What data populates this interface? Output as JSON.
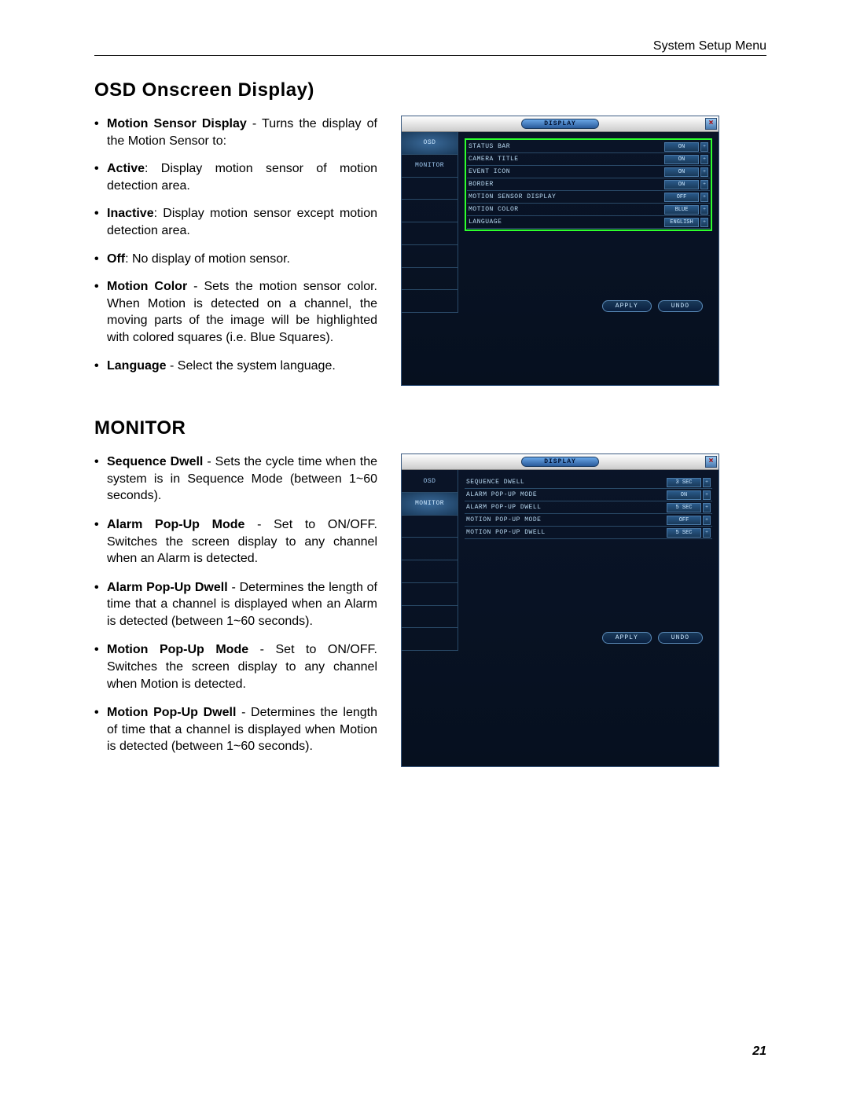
{
  "header": {
    "label": "System Setup Menu"
  },
  "page_number": "21",
  "section1": {
    "title": "OSD Onscreen Display)",
    "items": [
      {
        "bold": "Motion Sensor Display",
        "text": " - Turns the display of the Motion Sensor to:"
      }
    ],
    "sub_items": [
      {
        "bold": "Active",
        "text": ": Display motion sensor of motion detection area."
      },
      {
        "bold": "Inactive",
        "text": ": Display motion sensor except motion detection area."
      },
      {
        "bold": "Off",
        "text": ": No display of motion sensor."
      },
      {
        "bold": "Motion Color",
        "text": " - Sets the motion sensor color. When Motion is detected on a channel, the moving parts of the image will be highlighted with colored squares (i.e. Blue Squares)."
      },
      {
        "bold": "Language",
        "text": " - Select the system language."
      }
    ]
  },
  "section2": {
    "title": "MONITOR",
    "items": [
      {
        "bold": "Sequence Dwell",
        "text": " - Sets the cycle time when the system is in Sequence Mode (between 1~60 seconds)."
      },
      {
        "bold": "Alarm Pop-Up Mode",
        "text": " - Set to ON/OFF. Switches the screen display to any channel when an Alarm is detected."
      },
      {
        "bold": "Alarm Pop-Up Dwell",
        "text": " - Determines the length of time that a channel is displayed when an Alarm is detected (between 1~60 seconds)."
      },
      {
        "bold": "Motion Pop-Up Mode",
        "text": " - Set to ON/OFF. Switches the screen display to any channel when Motion is detected."
      },
      {
        "bold": "Motion Pop-Up Dwell",
        "text": " - Determines the length of time that a channel is displayed when Motion is detected (between 1~60 seconds)."
      }
    ]
  },
  "dvr1": {
    "title": "DISPLAY",
    "tabs": [
      "OSD",
      "MONITOR"
    ],
    "active_tab": 0,
    "rows": [
      {
        "label": "STATUS BAR",
        "value": "ON"
      },
      {
        "label": "CAMERA TITLE",
        "value": "ON"
      },
      {
        "label": "EVENT ICON",
        "value": "ON"
      },
      {
        "label": "BORDER",
        "value": "ON"
      },
      {
        "label": "MOTION SENSOR DISPLAY",
        "value": "OFF"
      },
      {
        "label": "MOTION COLOR",
        "value": "BLUE"
      },
      {
        "label": "LANGUAGE",
        "value": "ENGLISH"
      }
    ],
    "apply": "APPLY",
    "undo": "UNDO"
  },
  "dvr2": {
    "title": "DISPLAY",
    "tabs": [
      "OSD",
      "MONITOR"
    ],
    "active_tab": 1,
    "rows": [
      {
        "label": "SEQUENCE DWELL",
        "value": "3 SEC"
      },
      {
        "label": "ALARM POP-UP MODE",
        "value": "ON"
      },
      {
        "label": "ALARM POP-UP DWELL",
        "value": "5 SEC"
      },
      {
        "label": "MOTION POP-UP MODE",
        "value": "OFF"
      },
      {
        "label": "MOTION POP-UP DWELL",
        "value": "5 SEC"
      }
    ],
    "apply": "APPLY",
    "undo": "UNDO"
  }
}
